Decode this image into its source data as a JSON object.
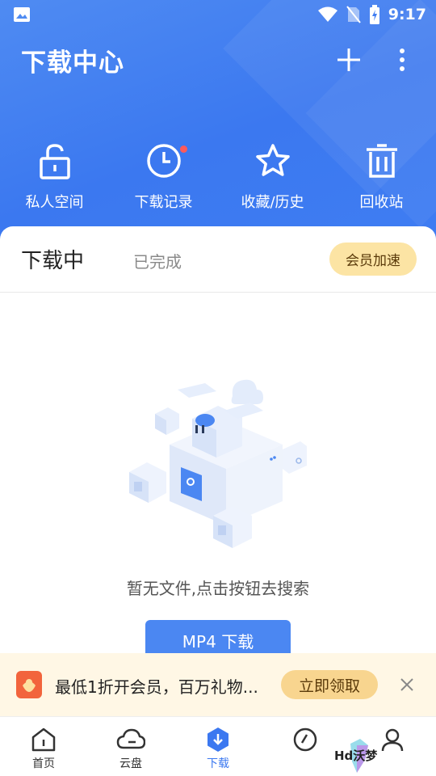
{
  "status_bar": {
    "time": "9:17"
  },
  "header": {
    "title": "下载中心",
    "quick_actions": [
      {
        "label": "私人空间",
        "icon": "unlock-icon"
      },
      {
        "label": "下载记录",
        "icon": "clock-icon"
      },
      {
        "label": "收藏/历史",
        "icon": "star-icon"
      },
      {
        "label": "回收站",
        "icon": "trash-icon"
      }
    ]
  },
  "tabs": {
    "active": "下载中",
    "inactive": "已完成",
    "vip_label": "会员加速"
  },
  "empty_state": {
    "message": "暂无文件,点击按钮去搜索",
    "button_label": "MP4 下载"
  },
  "promo": {
    "text": "最低1折开会员，百万礼物...",
    "button_label": "立即领取"
  },
  "bottom_nav": {
    "items": [
      {
        "label": "首页",
        "icon": "home-icon"
      },
      {
        "label": "云盘",
        "icon": "cloud-icon"
      },
      {
        "label": "下载",
        "icon": "download-icon",
        "active": true
      },
      {
        "label": "",
        "icon": "compass-icon"
      },
      {
        "label": "",
        "icon": "profile-icon"
      }
    ]
  },
  "watermark": {
    "text": "Hd沃梦"
  },
  "colors": {
    "primary": "#3b78f0",
    "vip_bg": "#fce4a4",
    "promo_bg": "#fff7e5",
    "badge_red": "#ff5a5a"
  }
}
